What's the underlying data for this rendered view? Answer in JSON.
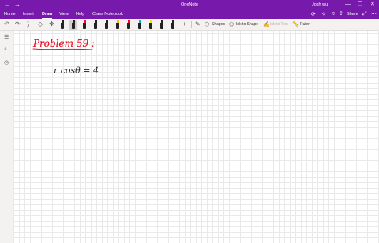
{
  "titlebar": {
    "back_glyph": "←",
    "forward_glyph": "→",
    "title": "OneNote",
    "user": "Josh wu",
    "minimize_glyph": "—",
    "restore_glyph": "❐",
    "close_glyph": "✕"
  },
  "menu": {
    "tabs": [
      {
        "label": "Home"
      },
      {
        "label": "Insert"
      },
      {
        "label": "Draw"
      },
      {
        "label": "View"
      },
      {
        "label": "Help"
      },
      {
        "label": "Class Notebook"
      }
    ],
    "active_tab": "Draw",
    "share_label": "Share"
  },
  "toolbar": {
    "undo_glyph": "↶",
    "redo_glyph": "↷",
    "shapes_label": "Shapes",
    "ink_to_shape_label": "Ink to Shape",
    "ink_to_text_label": "Ink to Text",
    "ruler_label": "Ruler",
    "pens": [
      {
        "color": "#222222",
        "tip": "#222222"
      },
      {
        "color": "#222222",
        "tip": "#222222"
      },
      {
        "color": "#222222",
        "tip": "#e81123"
      },
      {
        "color": "#222222",
        "tip": "#222222"
      },
      {
        "color": "#222222",
        "tip": "#222222"
      },
      {
        "color": "#222222",
        "tip": "#ffb900"
      },
      {
        "color": "#222222",
        "tip": "#e81123"
      },
      {
        "color": "#222222",
        "tip": "#00b7c3"
      },
      {
        "color": "#222222",
        "tip": "#fce100"
      },
      {
        "color": "#222222",
        "tip": "#222222"
      },
      {
        "color": "#222222",
        "tip": "#222222"
      }
    ]
  },
  "colors": {
    "accent": "#7719aa",
    "red_ink": "#e81123",
    "black_ink": "#222222"
  },
  "page": {
    "heading_ink": "Problem 59 :",
    "equation_ink": "r cosθ = 4"
  }
}
